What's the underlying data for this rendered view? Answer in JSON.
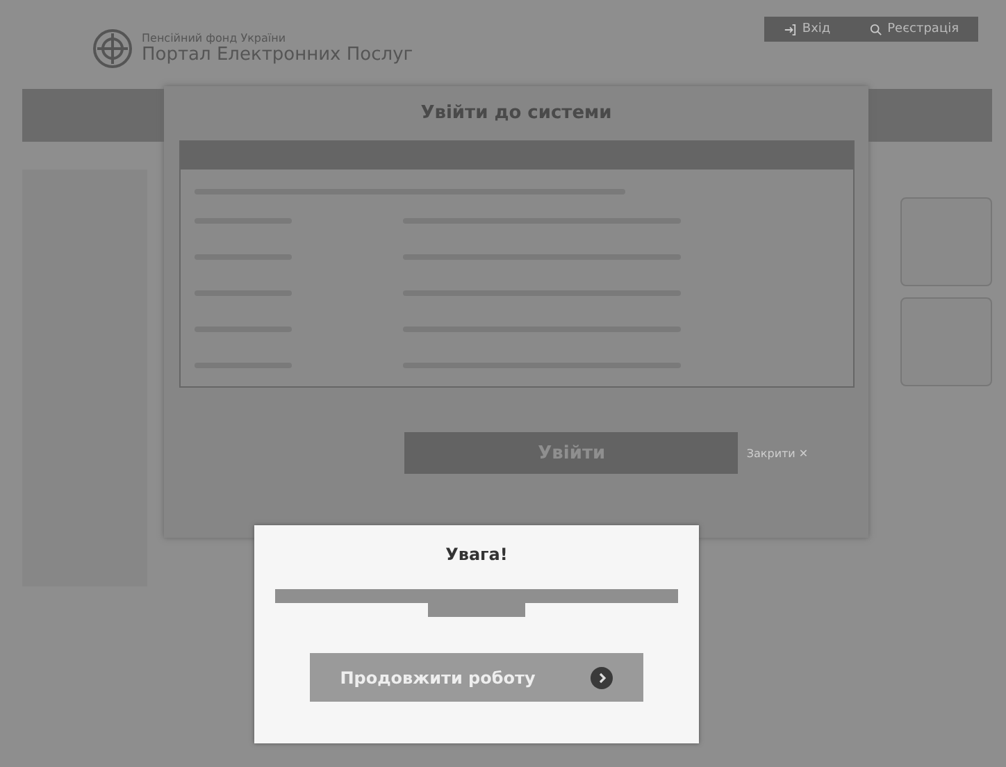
{
  "header": {
    "org": "Пенсійний фонд України",
    "title": "Портал Електронних Послуг",
    "buttons": [
      {
        "kind": "login",
        "label": "Вхід"
      },
      {
        "kind": "search",
        "label": "Реєстрація"
      }
    ]
  },
  "login_dialog": {
    "title": "Увійти до системи",
    "submit": "Увійти",
    "close": "Закрити",
    "close_icon": "✕"
  },
  "alert": {
    "title": "Увага!",
    "button": "Продовжити роботу"
  }
}
